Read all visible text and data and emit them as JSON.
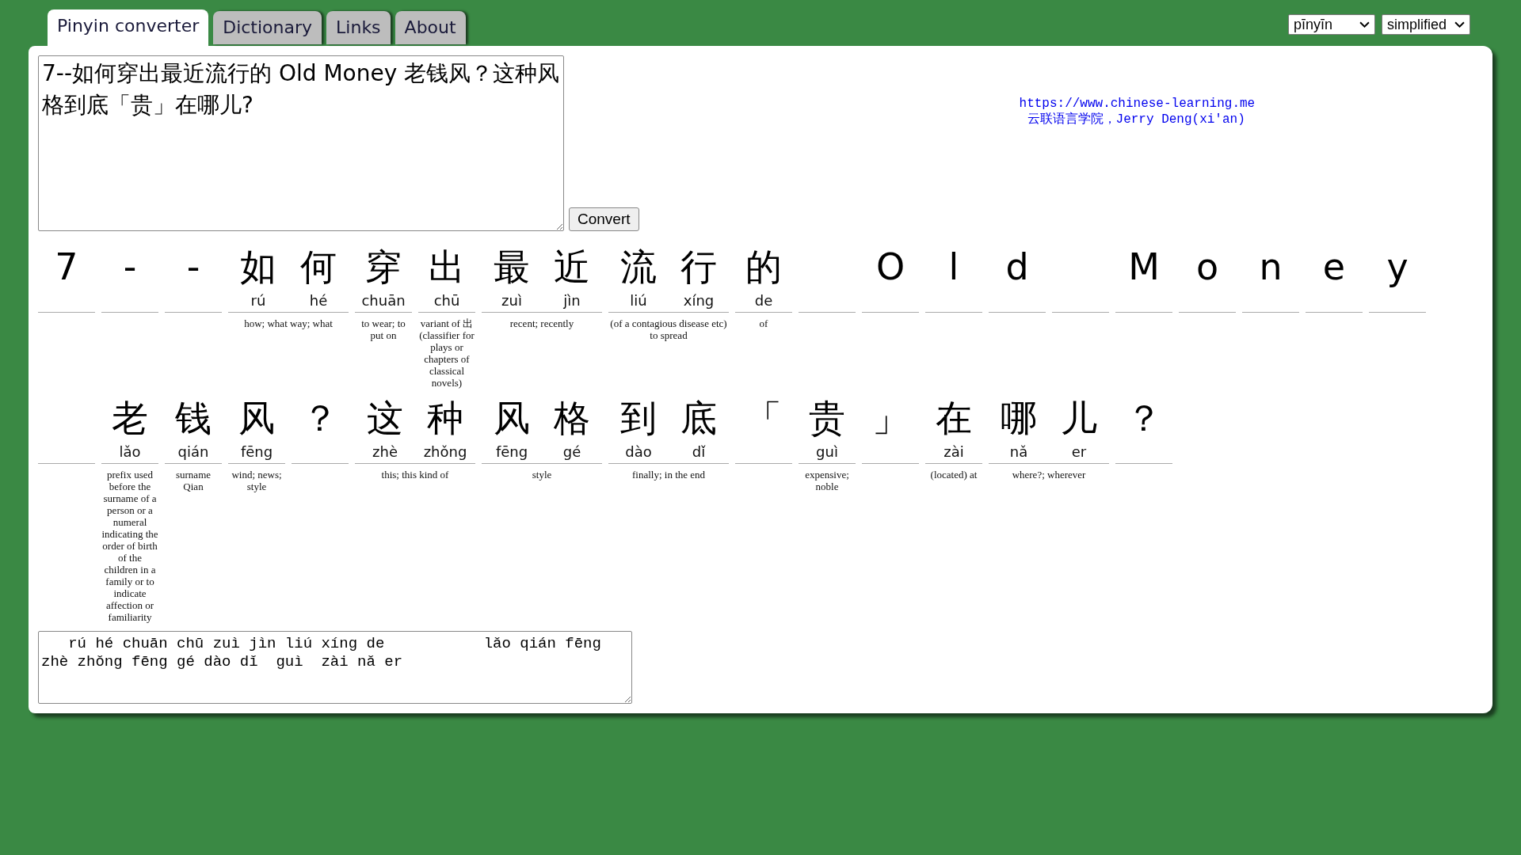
{
  "tabs": [
    {
      "label": "Pinyin converter",
      "selected": true
    },
    {
      "label": "Dictionary",
      "selected": false
    },
    {
      "label": "Links",
      "selected": false
    },
    {
      "label": "About",
      "selected": false
    }
  ],
  "selects": [
    {
      "value": "pīnyīn"
    },
    {
      "value": "simplified"
    }
  ],
  "input": {
    "value": "7--如何穿出最近流行的 Old Money 老钱风？这种风格到底「贵」在哪儿?"
  },
  "convert_button": "Convert",
  "credits": {
    "url": "https://www.chinese-learning.me",
    "author": "云联语言学院，Jerry Deng(xi'an)"
  },
  "groups": [
    {
      "kind": "word",
      "chars": [
        {
          "hanzi": "7"
        }
      ]
    },
    {
      "kind": "word",
      "chars": [
        {
          "hanzi": "-"
        }
      ]
    },
    {
      "kind": "word",
      "chars": [
        {
          "hanzi": "-"
        }
      ]
    },
    {
      "kind": "word",
      "chars": [
        {
          "hanzi": "如",
          "pinyin": "rú"
        },
        {
          "hanzi": "何",
          "pinyin": "hé"
        }
      ],
      "definition": "how; what way; what"
    },
    {
      "kind": "word",
      "chars": [
        {
          "hanzi": "穿",
          "pinyin": "chuān"
        }
      ],
      "definition": "to wear; to put on"
    },
    {
      "kind": "word",
      "chars": [
        {
          "hanzi": "出",
          "pinyin": "chū"
        }
      ],
      "definition": "variant of 出 (classifier for plays or chapters of classical novels)"
    },
    {
      "kind": "word",
      "chars": [
        {
          "hanzi": "最",
          "pinyin": "zuì"
        },
        {
          "hanzi": "近",
          "pinyin": "jìn"
        }
      ],
      "definition": "recent; recently"
    },
    {
      "kind": "word",
      "chars": [
        {
          "hanzi": "流",
          "pinyin": "liú"
        },
        {
          "hanzi": "行",
          "pinyin": "xíng"
        }
      ],
      "definition": "(of a contagious disease etc) to spread"
    },
    {
      "kind": "word",
      "chars": [
        {
          "hanzi": "的",
          "pinyin": "de"
        }
      ],
      "definition": "of"
    },
    {
      "kind": "blank"
    },
    {
      "kind": "word",
      "chars": [
        {
          "hanzi": "O"
        }
      ]
    },
    {
      "kind": "word",
      "chars": [
        {
          "hanzi": "l"
        }
      ]
    },
    {
      "kind": "word",
      "chars": [
        {
          "hanzi": "d"
        }
      ]
    },
    {
      "kind": "blank"
    },
    {
      "kind": "word",
      "chars": [
        {
          "hanzi": "M"
        }
      ]
    },
    {
      "kind": "word",
      "chars": [
        {
          "hanzi": "o"
        }
      ]
    },
    {
      "kind": "word",
      "chars": [
        {
          "hanzi": "n"
        }
      ]
    },
    {
      "kind": "word",
      "chars": [
        {
          "hanzi": "e"
        }
      ]
    },
    {
      "kind": "word",
      "chars": [
        {
          "hanzi": "y"
        }
      ]
    },
    {
      "kind": "blank"
    },
    {
      "kind": "word",
      "chars": [
        {
          "hanzi": "老",
          "pinyin": "lǎo"
        }
      ],
      "definition": "prefix used before the surname of a person or a numeral indicating the order of birth of the children in a family or to indicate affection or familiarity"
    },
    {
      "kind": "word",
      "chars": [
        {
          "hanzi": "钱",
          "pinyin": "qián"
        }
      ],
      "definition": "surname Qian"
    },
    {
      "kind": "word",
      "chars": [
        {
          "hanzi": "风",
          "pinyin": "fēng"
        }
      ],
      "definition": "wind; news; style"
    },
    {
      "kind": "word",
      "chars": [
        {
          "hanzi": "？"
        }
      ]
    },
    {
      "kind": "word",
      "chars": [
        {
          "hanzi": "这",
          "pinyin": "zhè"
        },
        {
          "hanzi": "种",
          "pinyin": "zhǒng"
        }
      ],
      "definition": "this; this kind of"
    },
    {
      "kind": "word",
      "chars": [
        {
          "hanzi": "风",
          "pinyin": "fēng"
        },
        {
          "hanzi": "格",
          "pinyin": "gé"
        }
      ],
      "definition": "style"
    },
    {
      "kind": "word",
      "chars": [
        {
          "hanzi": "到",
          "pinyin": "dào"
        },
        {
          "hanzi": "底",
          "pinyin": "dǐ"
        }
      ],
      "definition": "finally; in the end"
    },
    {
      "kind": "word",
      "chars": [
        {
          "hanzi": "「"
        }
      ]
    },
    {
      "kind": "word",
      "chars": [
        {
          "hanzi": "贵",
          "pinyin": "guì"
        }
      ],
      "definition": "expensive; noble"
    },
    {
      "kind": "word",
      "chars": [
        {
          "hanzi": "」"
        }
      ]
    },
    {
      "kind": "word",
      "chars": [
        {
          "hanzi": "在",
          "pinyin": "zài"
        }
      ],
      "definition": "(located) at"
    },
    {
      "kind": "word",
      "chars": [
        {
          "hanzi": "哪",
          "pinyin": "nǎ"
        },
        {
          "hanzi": "儿",
          "pinyin": "er"
        }
      ],
      "definition": "where?; wherever"
    },
    {
      "kind": "word",
      "chars": [
        {
          "hanzi": "？"
        }
      ]
    }
  ],
  "output": {
    "value": "   rú hé chuān chū zuì jìn liú xíng de           lǎo qián fēng  zhè zhǒng fēng gé dào dǐ  guì  zài nǎ er"
  }
}
